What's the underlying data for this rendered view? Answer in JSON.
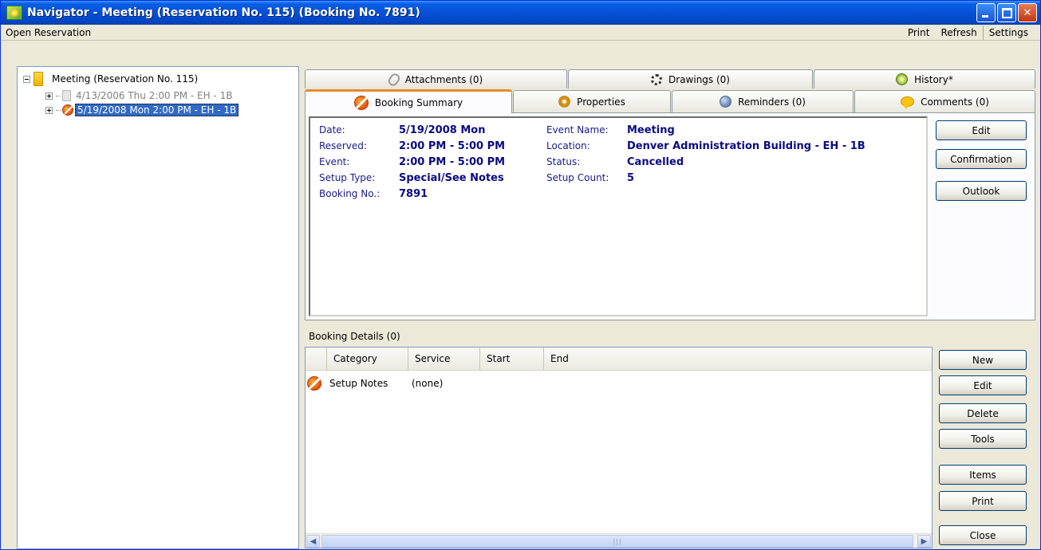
{
  "window": {
    "title": "Navigator - Meeting (Reservation No. 115) (Booking No. 7891)"
  },
  "menu": {
    "left": "Open Reservation",
    "right": [
      "Print",
      "Refresh",
      "Settings"
    ]
  },
  "tree": {
    "root": "Meeting (Reservation No. 115)",
    "children": [
      {
        "label": "4/13/2006 Thu 2:00 PM - EH - 1B",
        "selected": false
      },
      {
        "label": "5/19/2008 Mon 2:00 PM - EH - 1B",
        "selected": true
      }
    ]
  },
  "tabs": {
    "row1": [
      "Attachments (0)",
      "Drawings (0)",
      "History*"
    ],
    "row2": [
      "Booking Summary",
      "Properties",
      "Reminders (0)",
      "Comments (0)"
    ]
  },
  "summary": {
    "left": [
      {
        "label": "Date:",
        "value": "5/19/2008 Mon"
      },
      {
        "label": "Reserved:",
        "value": "2:00 PM - 5:00 PM"
      },
      {
        "label": "Event:",
        "value": "2:00 PM - 5:00 PM"
      },
      {
        "label": "Setup Type:",
        "value": "Special/See Notes"
      },
      {
        "label": "Booking No.:",
        "value": "7891"
      }
    ],
    "right": [
      {
        "label": "Event Name:",
        "value": "Meeting"
      },
      {
        "label": "Location:",
        "value": "Denver Administration Building - EH - 1B"
      },
      {
        "label": "Status:",
        "value": "Cancelled"
      },
      {
        "label": "Setup Count:",
        "value": "5"
      }
    ]
  },
  "summary_buttons": [
    "Edit",
    "Confirmation",
    "Outlook"
  ],
  "details": {
    "label": "Booking Details (0)",
    "columns": [
      "Category",
      "Service",
      "Start",
      "End"
    ],
    "rows": [
      {
        "category": "Setup Notes",
        "service": "(none)"
      }
    ]
  },
  "detail_buttons": [
    "New",
    "Edit",
    "Delete",
    "Tools",
    "Items",
    "Print",
    "Close"
  ]
}
